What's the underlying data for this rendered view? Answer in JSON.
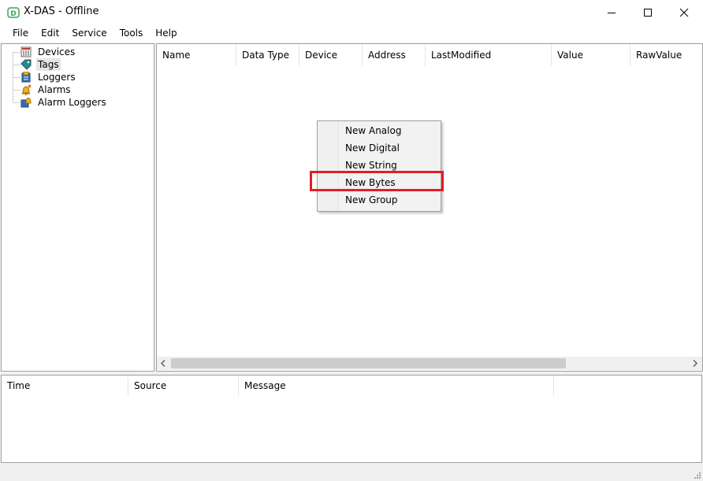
{
  "window": {
    "title": "X-DAS - Offline"
  },
  "menu": {
    "items": [
      "File",
      "Edit",
      "Service",
      "Tools",
      "Help"
    ]
  },
  "tree": {
    "items": [
      {
        "label": "Devices",
        "icon": "devices-icon"
      },
      {
        "label": "Tags",
        "icon": "tag-icon",
        "selected": true
      },
      {
        "label": "Loggers",
        "icon": "logger-icon"
      },
      {
        "label": "Alarms",
        "icon": "alarm-bell-icon"
      },
      {
        "label": "Alarm Loggers",
        "icon": "alarm-logger-icon"
      }
    ]
  },
  "tags_list": {
    "columns": [
      "Name",
      "Data Type",
      "Device",
      "Address",
      "LastModified",
      "Value",
      "RawValue"
    ]
  },
  "context_menu": {
    "items": [
      "New Analog",
      "New Digital",
      "New String",
      "New Bytes",
      "New Group"
    ],
    "highlighted": "New Bytes",
    "highlight_color": "#e31e24"
  },
  "log": {
    "columns": [
      "Time",
      "Source",
      "Message",
      ""
    ]
  }
}
